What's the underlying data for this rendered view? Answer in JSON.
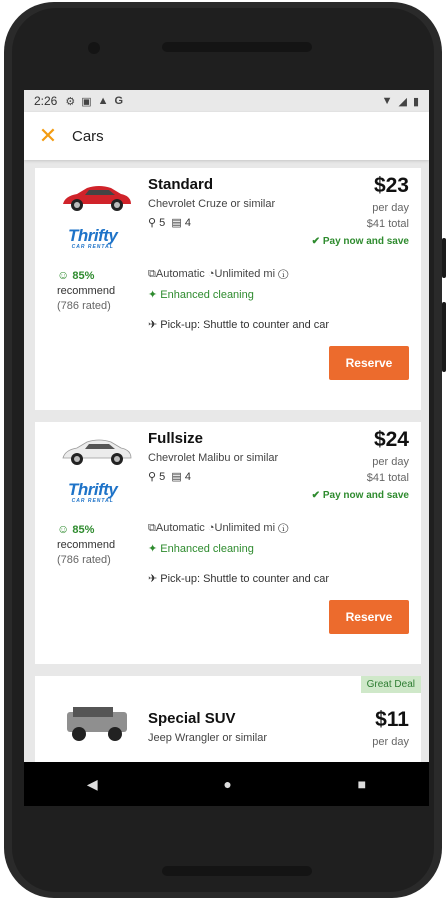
{
  "status": {
    "time": "2:26",
    "icons": [
      "gear-icon",
      "image-icon",
      "warning-icon",
      "google-icon"
    ],
    "right_icons": [
      "wifi-icon",
      "signal-icon",
      "battery-icon"
    ]
  },
  "appbar": {
    "title": "Cars"
  },
  "cards": [
    {
      "class": "Standard",
      "model": "Chevrolet Cruze or similar",
      "seats": "5",
      "bags": "4",
      "price": "$23",
      "per_day": "per day",
      "total": "$41 total",
      "pay_now": "Pay now and save",
      "brand": "Thrifty",
      "brand_sub": "CAR RENTAL",
      "recommend_pct": "85%",
      "recommend_label": "recommend",
      "rated": "(786 rated)",
      "transmission": "Automatic",
      "mileage": "Unlimited mi",
      "cleaning": "Enhanced cleaning",
      "pickup": "Pick-up: Shuttle to counter and car",
      "reserve": "Reserve",
      "car_color": "#d0232a"
    },
    {
      "class": "Fullsize",
      "model": "Chevrolet Malibu or similar",
      "seats": "5",
      "bags": "4",
      "price": "$24",
      "per_day": "per day",
      "total": "$41 total",
      "pay_now": "Pay now and save",
      "brand": "Thrifty",
      "brand_sub": "CAR RENTAL",
      "recommend_pct": "85%",
      "recommend_label": "recommend",
      "rated": "(786 rated)",
      "transmission": "Automatic",
      "mileage": "Unlimited mi",
      "cleaning": "Enhanced cleaning",
      "pickup": "Pick-up: Shuttle to counter and car",
      "reserve": "Reserve",
      "car_color": "#e8e8e8"
    },
    {
      "class": "Special SUV",
      "model": "Jeep Wrangler or similar",
      "price": "$11",
      "per_day": "per day",
      "deal": "Great Deal",
      "car_color": "#9a9a9a"
    }
  ],
  "colors": {
    "accent": "#f39c12",
    "reserve": "#ec6b2d",
    "green": "#2e8b2e",
    "brand": "#1e73c8"
  }
}
